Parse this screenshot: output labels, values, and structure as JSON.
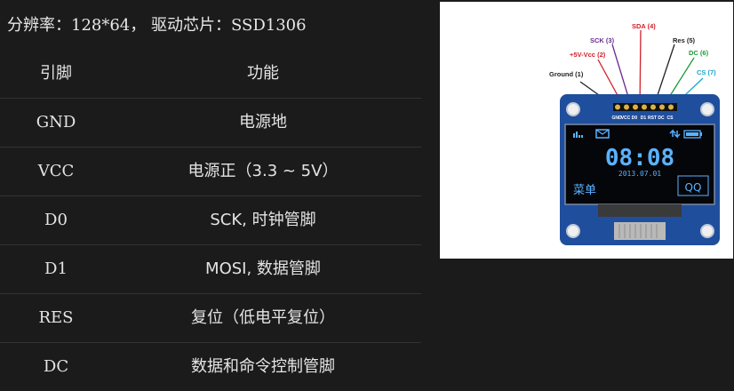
{
  "header": {
    "text": "分辨率：128*64， 驱动芯片：SSD1306"
  },
  "table": {
    "columns": [
      "引脚",
      "功能"
    ],
    "rows": [
      {
        "pin": "GND",
        "func": "电源地"
      },
      {
        "pin": "VCC",
        "func": "电源正（3.3 ~ 5V）"
      },
      {
        "pin": "D0",
        "func": "SCK, 时钟管脚"
      },
      {
        "pin": "D1",
        "func": "MOSI, 数据管脚"
      },
      {
        "pin": "RES",
        "func": "复位（低电平复位）"
      },
      {
        "pin": "DC",
        "func": "数据和命令控制管脚"
      }
    ]
  },
  "figure": {
    "callouts": [
      {
        "text": "Ground (1)",
        "color": "#222222"
      },
      {
        "text": "+5V-Vcc (2)",
        "color": "#d0202a"
      },
      {
        "text": "SCK (3)",
        "color": "#6a2c91"
      },
      {
        "text": "SDA (4)",
        "color": "#d0202a"
      },
      {
        "text": "Res (5)",
        "color": "#222222"
      },
      {
        "text": "DC (6)",
        "color": "#1a9a3a"
      },
      {
        "text": "CS (7)",
        "color": "#1aa7c8"
      }
    ],
    "pin_labels": [
      "GND",
      "VCC",
      "D0",
      "D1",
      "RST",
      "DC",
      "CS"
    ],
    "screen": {
      "time": "08:08",
      "date": "2013.07.01",
      "menu": "菜单",
      "qq": "QQ"
    },
    "colors": {
      "board": "#1f4e9c",
      "screen": "#05060a",
      "text": "#5ab2ff"
    }
  }
}
